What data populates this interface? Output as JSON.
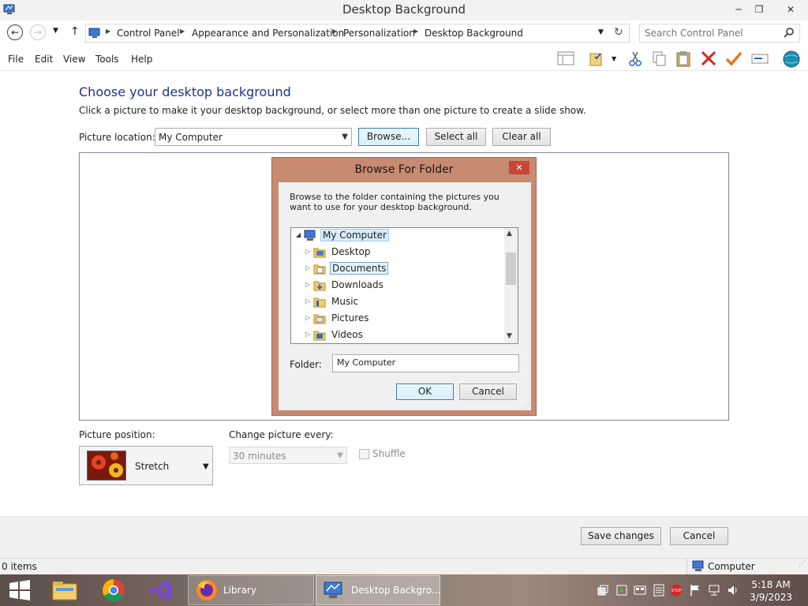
{
  "window": {
    "title": "Desktop Background"
  },
  "address": {
    "breadcrumbs": [
      "Control Panel",
      "Appearance and Personalization",
      "Personalization",
      "Desktop Background"
    ],
    "search_placeholder": "Search Control Panel"
  },
  "menu": [
    "File",
    "Edit",
    "View",
    "Tools",
    "Help"
  ],
  "toolbar_icons": [
    "layout-icon",
    "properties-icon",
    "cut-icon",
    "copy-icon",
    "paste-icon",
    "delete-icon",
    "check-icon",
    "rename-icon",
    "globe-icon"
  ],
  "page": {
    "heading": "Choose your desktop background",
    "subtext": "Click a picture to make it your desktop background, or select more than one picture to create a slide show.",
    "picture_location_label": "Picture location:",
    "picture_location_value": "My Computer",
    "browse_label": "Browse...",
    "select_all_label": "Select all",
    "clear_all_label": "Clear all",
    "picture_position_label": "Picture position:",
    "picture_position_value": "Stretch",
    "change_every_label": "Change picture every:",
    "change_every_value": "30 minutes",
    "shuffle_label": "Shuffle",
    "save_label": "Save changes",
    "cancel_label": "Cancel"
  },
  "dialog": {
    "title": "Browse For Folder",
    "instructions": "Browse to the folder containing the pictures you want to use for your desktop background.",
    "tree": [
      {
        "label": "My Computer",
        "state": "selected",
        "expanded": true
      },
      {
        "label": "Desktop",
        "state": ""
      },
      {
        "label": "Documents",
        "state": "focused"
      },
      {
        "label": "Downloads",
        "state": ""
      },
      {
        "label": "Music",
        "state": ""
      },
      {
        "label": "Pictures",
        "state": ""
      },
      {
        "label": "Videos",
        "state": ""
      }
    ],
    "folder_label": "Folder:",
    "folder_value": "My Computer",
    "ok_label": "OK",
    "cancel_label": "Cancel"
  },
  "statusbar": {
    "items": "0 items",
    "location": "Computer"
  },
  "taskbar": {
    "apps": [
      {
        "name": "start-button"
      },
      {
        "name": "file-explorer-icon"
      },
      {
        "name": "chrome-icon"
      },
      {
        "name": "visual-studio-icon"
      }
    ],
    "windows": [
      {
        "label": "Library"
      },
      {
        "label": "Desktop Backgro..."
      }
    ],
    "clock": {
      "time": "5:18 AM",
      "date": "3/9/2023"
    }
  },
  "colors": {
    "heading": "#1e3287",
    "dialog_frame": "#c88a70",
    "close_red": "#c7463c",
    "selection": "#d9ebf9"
  }
}
